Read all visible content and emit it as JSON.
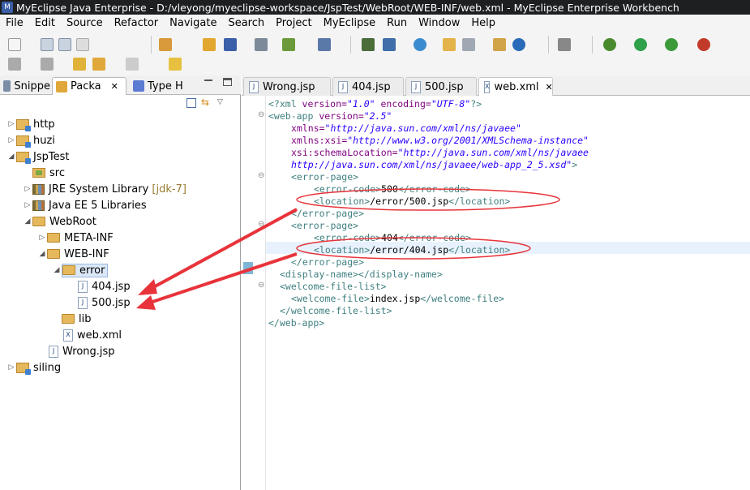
{
  "window": {
    "title": "MyEclipse Java Enterprise - D:/vleyong/myeclipse-workspace/JspTest/WebRoot/WEB-INF/web.xml - MyEclipse Enterprise Workbench"
  },
  "menu": [
    "File",
    "Edit",
    "Source",
    "Refactor",
    "Navigate",
    "Search",
    "Project",
    "MyEclipse",
    "Run",
    "Window",
    "Help"
  ],
  "left_tabs": [
    {
      "label": "Snippe"
    },
    {
      "label": "Packa"
    },
    {
      "label": "Type H"
    }
  ],
  "tree": [
    {
      "label": "http"
    },
    {
      "label": "huzi"
    },
    {
      "label": "JspTest"
    },
    {
      "label": "src"
    },
    {
      "label": "JRE System Library",
      "extra": "[jdk-7]"
    },
    {
      "label": "Java EE 5 Libraries"
    },
    {
      "label": "WebRoot"
    },
    {
      "label": "META-INF"
    },
    {
      "label": "WEB-INF"
    },
    {
      "label": "error"
    },
    {
      "label": "404.jsp"
    },
    {
      "label": "500.jsp"
    },
    {
      "label": "lib"
    },
    {
      "label": "web.xml"
    },
    {
      "label": "Wrong.jsp"
    },
    {
      "label": "siling"
    }
  ],
  "editor_tabs": [
    {
      "label": "Wrong.jsp"
    },
    {
      "label": "404.jsp"
    },
    {
      "label": "500.jsp"
    },
    {
      "label": "web.xml"
    }
  ],
  "code": {
    "l1_pi_open": "<?xml ",
    "l1_attr1": "version=",
    "l1_val1": "\"1.0\"",
    "l1_attr2": " encoding=",
    "l1_val2": "\"UTF-8\"",
    "l1_pi_close": "?>",
    "l2_tag": "<web-app ",
    "l2_attr": "version=",
    "l2_val": "\"2.5\"",
    "l3_attr": "xmlns=",
    "l3_val": "\"http://java.sun.com/xml/ns/javaee\"",
    "l4_attr": "xmlns:xsi=",
    "l4_val": "\"http://www.w3.org/2001/XMLSchema-instance\"",
    "l5_attr": "xsi:schemaLocation=",
    "l5_val": "\"http://java.sun.com/xml/ns/javaee",
    "l6_val": "http://java.sun.com/xml/ns/javaee/web-app_2_5.xsd\"",
    "l6_close": ">",
    "l7": "<error-page>",
    "l8_open": "<error-code>",
    "l8_text": "500",
    "l8_close": "</error-code>",
    "l9_open": "<location>",
    "l9_text": "/error/500.jsp",
    "l9_close": "</location>",
    "l10": "</error-page>",
    "l11": "<error-page>",
    "l12_open": "<error-code>",
    "l12_text": "404",
    "l12_close": "</error-code>",
    "l13_open": "<location>",
    "l13_text": "/error/404.jsp",
    "l13_close": "</location>",
    "l14": "</error-page>",
    "l15": "<display-name></display-name>",
    "l16": "<welcome-file-list>",
    "l17_open": "<welcome-file>",
    "l17_text": "index.jsp",
    "l17_close": "</welcome-file>",
    "l18": "</welcome-file-list>",
    "l19": "</web-app>"
  },
  "colors": {
    "tag": "#3f7f7f",
    "attr": "#7f007f",
    "value": "#2a00ff",
    "annotation": "#e8333a"
  },
  "icons": [
    "new-icon",
    "save-icon",
    "print-icon",
    "run-icon",
    "debug-icon",
    "search-icon",
    "back-icon",
    "forward-icon",
    "close-icon",
    "minimize-icon",
    "maximize-icon"
  ]
}
